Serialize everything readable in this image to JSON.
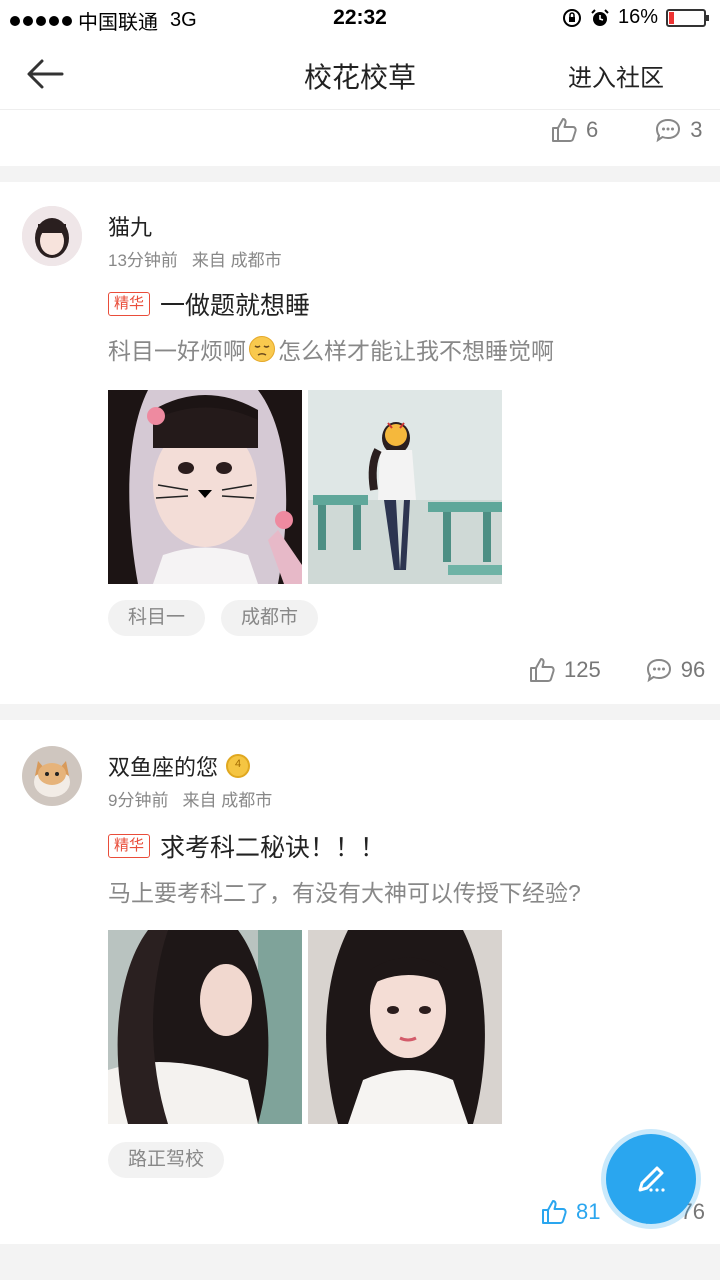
{
  "status_bar": {
    "carrier": "中国联通",
    "network": "3G",
    "time": "22:32",
    "battery": "16%",
    "battery_level": 0.16,
    "signal_dots": 5
  },
  "nav": {
    "title": "校花校草",
    "enter_label": "进入社区"
  },
  "prev_post": {
    "likes": "6",
    "comments": "3"
  },
  "posts": [
    {
      "username": "猫九",
      "time_ago": "13分钟前",
      "source": "来自 成都市",
      "badge": "精华",
      "title": "一做题就想睡",
      "body_before": "科目一好烦啊",
      "emoji": "pensive-face",
      "body_after": "怎么样才能让我不想睡觉啊",
      "tags": [
        "科目一",
        "成都市"
      ],
      "likes": "125",
      "comments": "96"
    },
    {
      "username": "双鱼座的您",
      "medal_number": "4",
      "time_ago": "9分钟前",
      "source": "来自 成都市",
      "badge": "精华",
      "title": "求考科二秘诀！！！",
      "body": "马上要考科二了，有没有大神可以传授下经验?",
      "tags": [
        "路正驾校"
      ],
      "likes": "81",
      "comments": "76"
    }
  ],
  "colors": {
    "accent": "#2aa6ef",
    "badge": "#e94d3a",
    "muted": "#888888"
  }
}
